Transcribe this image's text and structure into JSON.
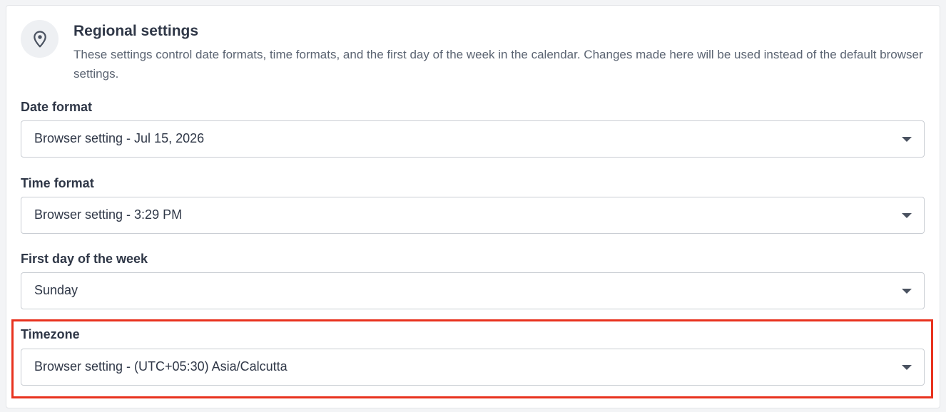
{
  "section": {
    "title": "Regional settings",
    "description": "These settings control date formats, time formats, and the first day of the week in the calendar. Changes made here will be used instead of the default browser settings.",
    "icon": "location-pin-icon"
  },
  "fields": {
    "date_format": {
      "label": "Date format",
      "value": "Browser setting - Jul 15, 2026"
    },
    "time_format": {
      "label": "Time format",
      "value": "Browser setting - 3:29 PM"
    },
    "first_day": {
      "label": "First day of the week",
      "value": "Sunday"
    },
    "timezone": {
      "label": "Timezone",
      "value": "Browser setting - (UTC+05:30) Asia/Calcutta"
    }
  },
  "colors": {
    "highlight": "#e8321e",
    "text": "#2f3747",
    "muted_text": "#5b6472",
    "border": "#c9cdd3"
  }
}
